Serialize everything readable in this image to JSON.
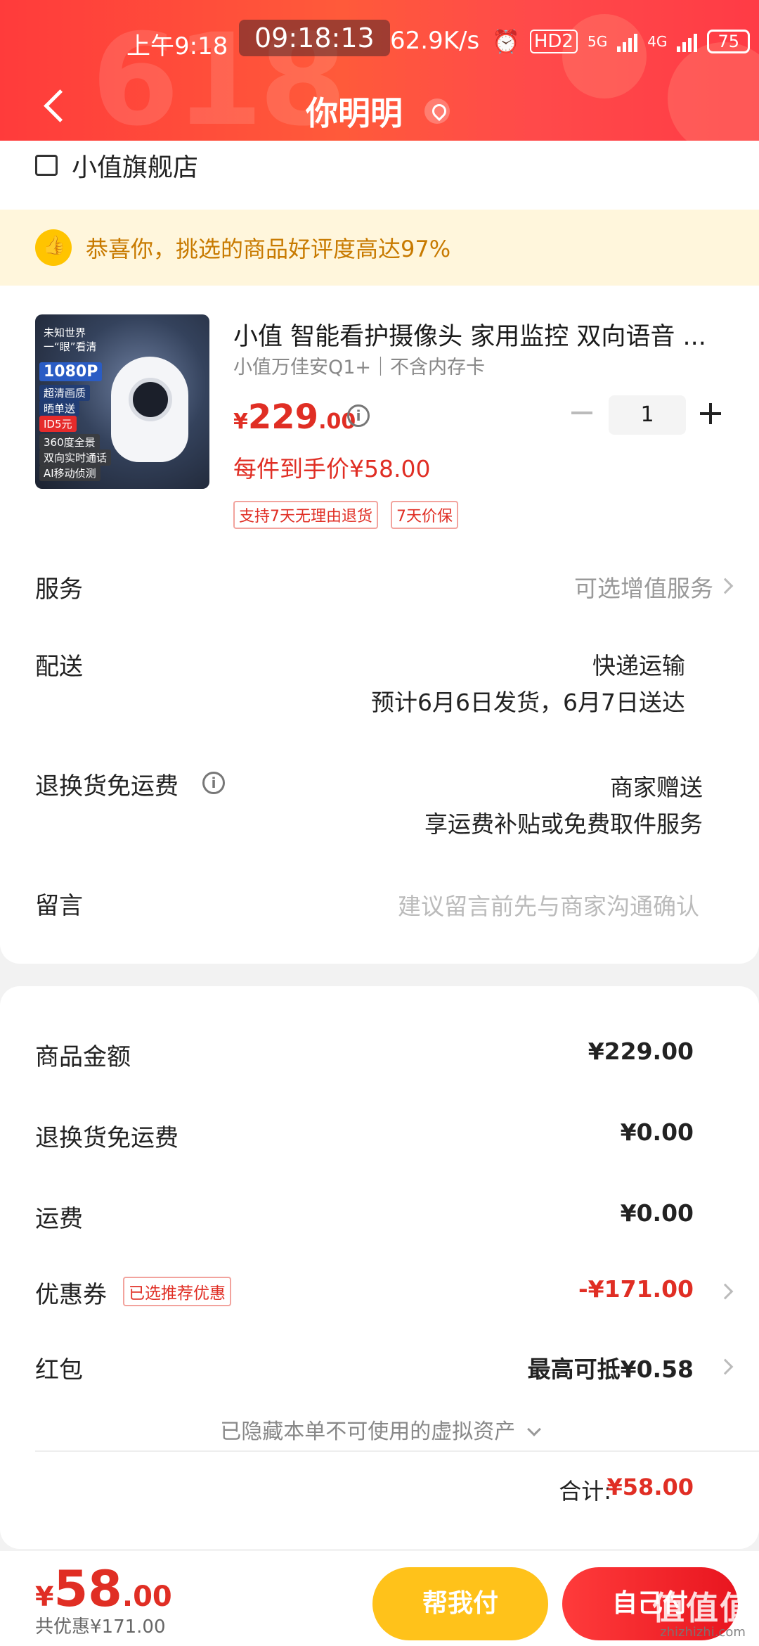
{
  "status_bar": {
    "time": "上午9:18",
    "clock": "09:18:13",
    "speed": "62.9K/s",
    "hd": "HD2",
    "net1": "5G",
    "net2": "4G",
    "battery": "75"
  },
  "header": {
    "deco": "618",
    "title": "你明明"
  },
  "store": {
    "name": "小值旗舰店"
  },
  "notice": {
    "text": "恭喜你，挑选的商品好评度高达97%"
  },
  "product": {
    "name": "小值 智能看护摄像头  家用监控 双向语音 ...",
    "spec": "小值万佳安Q1+｜不含内存卡",
    "price_currency": "¥",
    "price_int": "229",
    "price_dec": ".00",
    "quantity": "1",
    "hand_price": "每件到手价¥58.00",
    "tags": [
      "支持7天无理由退货",
      "7天价保"
    ],
    "image_texts": [
      "未知世界",
      "一“眼”看清",
      "1080P",
      "超清画质",
      "晒单送",
      "ID5元",
      "360度全景",
      "双向实时通话",
      "AI移动侦测"
    ]
  },
  "rows": {
    "service_label": "服务",
    "service_value": "可选增值服务",
    "delivery_label": "配送",
    "delivery_value1": "快递运输",
    "delivery_value2": "预计6月6日发货，6月7日送达",
    "freight_label": "退换货免运费",
    "freight_value1": "商家赠送",
    "freight_value2": "享运费补贴或免费取件服务",
    "message_label": "留言",
    "message_placeholder": "建议留言前先与商家沟通确认"
  },
  "summary": {
    "goods_label": "商品金额",
    "goods_value": "¥229.00",
    "return_label": "退换货免运费",
    "return_value": "¥0.00",
    "shipping_label": "运费",
    "shipping_value": "¥0.00",
    "coupon_label": "优惠券",
    "coupon_tag": "已选推荐优惠",
    "coupon_value": "-¥171.00",
    "redpacket_label": "红包",
    "redpacket_value": "最高可抵¥0.58",
    "hidden_assets": "已隐藏本单不可使用的虚拟资产",
    "total_label": "合计:",
    "total_value": "¥58.00"
  },
  "bottom_bar": {
    "currency": "¥",
    "total_int": "58",
    "total_dec": ".00",
    "discount": "共优惠¥171.00",
    "help_pay": "帮我付",
    "self_pay": "自己付",
    "watermark": "值值值",
    "watermark_sub": "zhizhizhi.com"
  },
  "colors": {
    "accent_red": "#e02e24",
    "header_red": "#ff3b3b",
    "help_yellow": "#ffc21a",
    "notice_bg": "#fff6dc",
    "notice_text": "#c87a00"
  }
}
